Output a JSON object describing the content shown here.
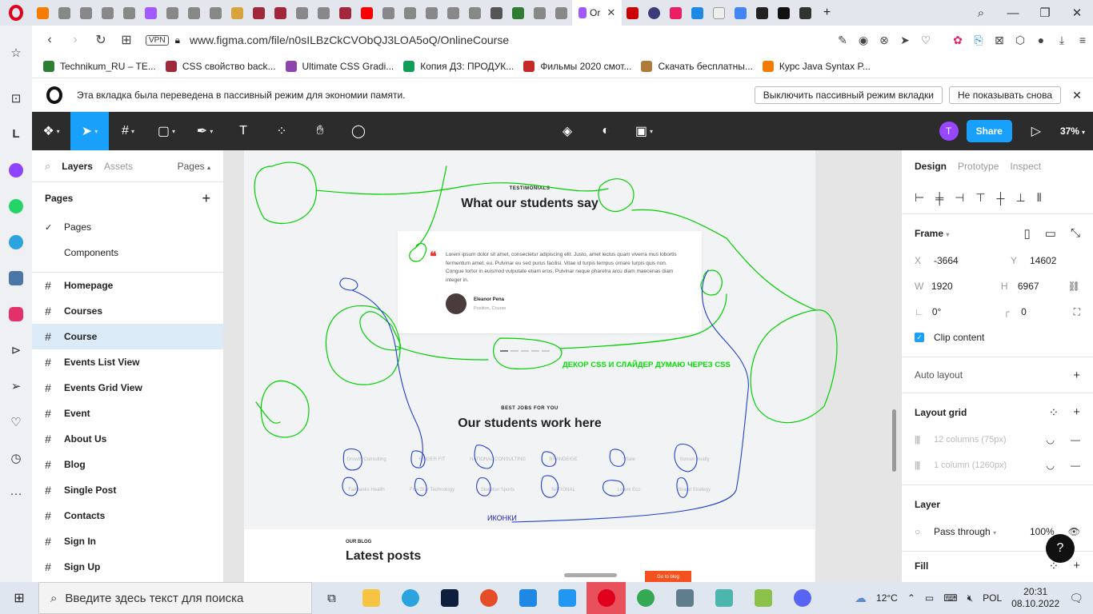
{
  "browser": {
    "active_tab_label": "Or",
    "url": "www.figma.com/file/n0sILBzCkCVObQJ3LOA5oQ/OnlineCourse",
    "vpn_label": "VPN",
    "bookmarks": [
      {
        "label": "Technikum_RU – TE...",
        "color": "#2e7d32"
      },
      {
        "label": "CSS свойство back...",
        "color": "#a1283a"
      },
      {
        "label": "Ultimate CSS Gradi...",
        "color": "#8e44ad"
      },
      {
        "label": "Копия ДЗ: ПРОДУК...",
        "color": "#0f9d58"
      },
      {
        "label": "Фильмы 2020 смот...",
        "color": "#c62828"
      },
      {
        "label": "Скачать бесплатны...",
        "color": "#b07a3a"
      },
      {
        "label": "Курс Java Syntax P...",
        "color": "#f57c00"
      }
    ],
    "infobar": {
      "message": "Эта вкладка была переведена в пассивный режим для экономии памяти.",
      "btn_disable": "Выключить пассивный режим вкладки",
      "btn_dont_show": "Не показывать снова"
    }
  },
  "figma": {
    "toolbar": {
      "avatar_letter": "T",
      "share_label": "Share",
      "zoom": "37%"
    },
    "left_panel": {
      "tabs": [
        "Layers",
        "Assets"
      ],
      "pages_dropdown": "Pages",
      "pages_heading": "Pages",
      "pages": [
        "Pages",
        "Components"
      ],
      "frames": [
        "Homepage",
        "Courses",
        "Course",
        "Events List View",
        "Events Grid View",
        "Event",
        "About Us",
        "Blog",
        "Single Post",
        "Contacts",
        "Sign In",
        "Sign Up"
      ],
      "selected_frame": "Course"
    },
    "canvas": {
      "testimonials_eyebrow": "TESTIMONIALS",
      "testimonials_title": "What our students say",
      "quote": "Lorem ipsum dolor sit amet, consectetur adipiscing elit. Justo, amet lectus quam viverra mus lobortis fermentum amet. eu. Pulvinar eu sed purus facilisi. Vitae id turpis tempus ornare turpis quis non. Congue tortor in euismod vulputate etiam eros. Pulvinar neque pharetra arcu diam maecenas diam integer in.",
      "author_name": "Eleanor Pena",
      "author_position": "Position, Course",
      "jobs_eyebrow": "BEST JOBS FOR YOU",
      "jobs_title": "Our students work here",
      "logos_row1": [
        "Growth Consulting",
        "FINGER FIT",
        "NATIONAL CONSULTING",
        "BRANDEIGE",
        "SSale",
        "Sunset Realty"
      ],
      "logos_row2": [
        "Fairbanks Health",
        "Five Star Technology",
        "Skeleton Sports",
        "NATIONAL",
        "Lorem Eco",
        "Brand Strategy"
      ],
      "blog_eyebrow": "OUR BLOG",
      "blog_title": "Latest posts",
      "goto_blog": "Go to blog",
      "note_green": "ДЕКОР CSS И СЛАЙДЕР ДУМАЮ ЧЕРЕЗ CSS",
      "note_blue": "ИКОНКИ",
      "slider_active_dot": 0,
      "slider_dot_count": 5
    },
    "right_panel": {
      "tabs": [
        "Design",
        "Prototype",
        "Inspect"
      ],
      "frame_label": "Frame",
      "x": "-3664",
      "y": "14602",
      "w": "1920",
      "h": "6967",
      "rotation": "0°",
      "radius": "0",
      "clip_content": "Clip content",
      "auto_layout": "Auto layout",
      "layout_grid": "Layout grid",
      "grids": [
        "12 columns (75px)",
        "1 column (1260px)"
      ],
      "layer_label": "Layer",
      "blend_mode": "Pass through",
      "opacity": "100%",
      "fill_label": "Fill",
      "help": "?"
    }
  },
  "taskbar": {
    "search_placeholder": "Введите здесь текст для поиска",
    "weather": "12°C",
    "lang": "POL",
    "time": "20:31",
    "date": "08.10.2022"
  },
  "colors": {
    "figma_accent": "#18a0fb",
    "opera_red": "#e0001b",
    "sketch_green": "#00d000",
    "sketch_blue": "#2040d0"
  }
}
